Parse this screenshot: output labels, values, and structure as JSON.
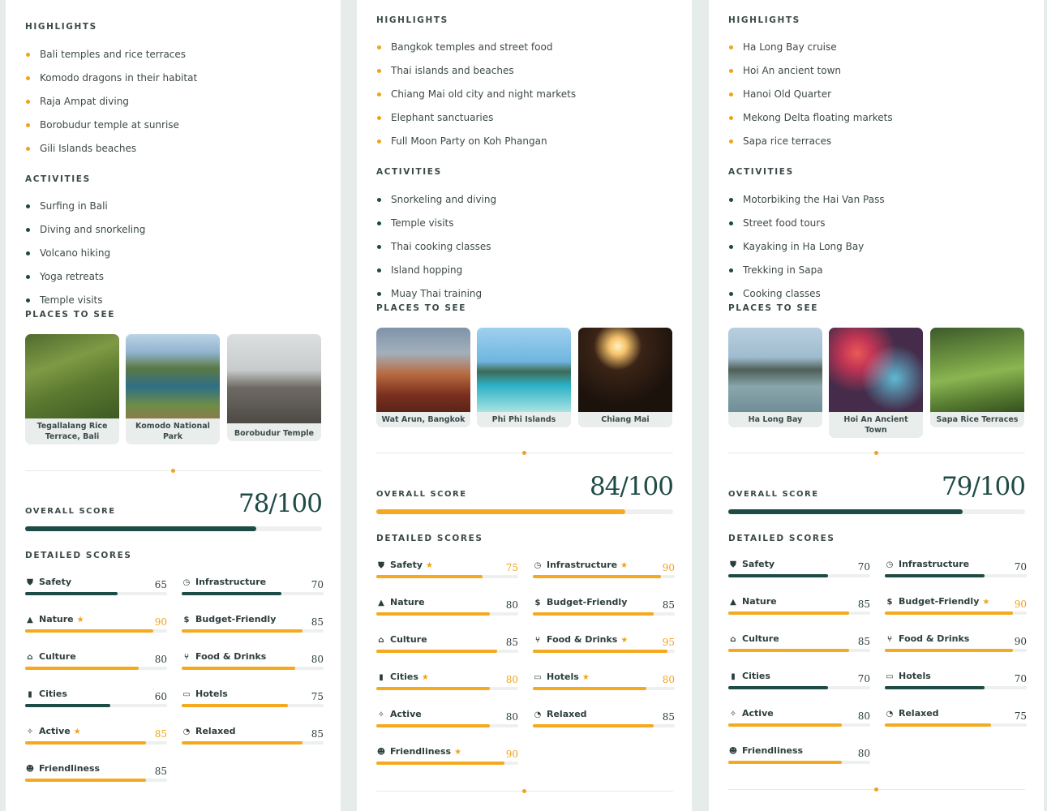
{
  "labels": {
    "highlights": "HIGHLIGHTS",
    "activities": "ACTIVITIES",
    "places": "PLACES TO SEE",
    "overall": "OVERALL SCORE",
    "detailed": "DETAILED SCORES"
  },
  "colors": {
    "accent": "#f0a21c",
    "dark_green": "#1d4b45",
    "background": "#e6ecea"
  },
  "destinations": [
    {
      "highlights": [
        "Bali temples and rice terraces",
        "Komodo dragons in their habitat",
        "Raja Ampat diving",
        "Borobudur temple at sunrise",
        "Gili Islands beaches"
      ],
      "activities": [
        "Surfing in Bali",
        "Diving and snorkeling",
        "Volcano hiking",
        "Yoga retreats",
        "Temple visits"
      ],
      "places": [
        "Tegallalang Rice Terrace, Bali",
        "Komodo National Park",
        "Borobudur Temple"
      ],
      "overall": "78/100",
      "overall_value": 78,
      "overall_bar_color": "dark_green",
      "scores": [
        {
          "name": "Safety",
          "icon": "shield-icon",
          "value": "65",
          "percent": 65,
          "star": false
        },
        {
          "name": "Infrastructure",
          "icon": "gauge-icon",
          "value": "70",
          "percent": 70,
          "star": false
        },
        {
          "name": "Nature",
          "icon": "mountain-icon",
          "value": "90",
          "percent": 90,
          "star": true
        },
        {
          "name": "Budget-Friendly",
          "icon": "dollar-icon",
          "value": "85",
          "percent": 85,
          "star": false
        },
        {
          "name": "Culture",
          "icon": "museum-icon",
          "value": "80",
          "percent": 80,
          "star": false
        },
        {
          "name": "Food & Drinks",
          "icon": "utensils-icon",
          "value": "80",
          "percent": 80,
          "star": false
        },
        {
          "name": "Cities",
          "icon": "city-icon",
          "value": "60",
          "percent": 60,
          "star": false
        },
        {
          "name": "Hotels",
          "icon": "bed-icon",
          "value": "75",
          "percent": 75,
          "star": false
        },
        {
          "name": "Active",
          "icon": "running-icon",
          "value": "85",
          "percent": 85,
          "star": true
        },
        {
          "name": "Relaxed",
          "icon": "clock-icon",
          "value": "85",
          "percent": 85,
          "star": false
        },
        {
          "name": "Friendliness",
          "icon": "smile-icon",
          "value": "85",
          "percent": 85,
          "star": false
        }
      ]
    },
    {
      "highlights": [
        "Bangkok temples and street food",
        "Thai islands and beaches",
        "Chiang Mai old city and night markets",
        "Elephant sanctuaries",
        "Full Moon Party on Koh Phangan"
      ],
      "activities": [
        "Snorkeling and diving",
        "Temple visits",
        "Thai cooking classes",
        "Island hopping",
        "Muay Thai training"
      ],
      "places": [
        "Wat Arun, Bangkok",
        "Phi Phi Islands",
        "Chiang Mai"
      ],
      "overall": "84/100",
      "overall_value": 84,
      "overall_bar_color": "gold",
      "scores": [
        {
          "name": "Safety",
          "icon": "shield-icon",
          "value": "75",
          "percent": 75,
          "star": true
        },
        {
          "name": "Infrastructure",
          "icon": "gauge-icon",
          "value": "90",
          "percent": 90,
          "star": true
        },
        {
          "name": "Nature",
          "icon": "mountain-icon",
          "value": "80",
          "percent": 80,
          "star": false
        },
        {
          "name": "Budget-Friendly",
          "icon": "dollar-icon",
          "value": "85",
          "percent": 85,
          "star": false
        },
        {
          "name": "Culture",
          "icon": "museum-icon",
          "value": "85",
          "percent": 85,
          "star": false
        },
        {
          "name": "Food & Drinks",
          "icon": "utensils-icon",
          "value": "95",
          "percent": 95,
          "star": true
        },
        {
          "name": "Cities",
          "icon": "city-icon",
          "value": "80",
          "percent": 80,
          "star": true
        },
        {
          "name": "Hotels",
          "icon": "bed-icon",
          "value": "80",
          "percent": 80,
          "star": true
        },
        {
          "name": "Active",
          "icon": "running-icon",
          "value": "80",
          "percent": 80,
          "star": false
        },
        {
          "name": "Relaxed",
          "icon": "clock-icon",
          "value": "85",
          "percent": 85,
          "star": false
        },
        {
          "name": "Friendliness",
          "icon": "smile-icon",
          "value": "90",
          "percent": 90,
          "star": true
        }
      ]
    },
    {
      "highlights": [
        "Ha Long Bay cruise",
        "Hoi An ancient town",
        "Hanoi Old Quarter",
        "Mekong Delta floating markets",
        "Sapa rice terraces"
      ],
      "activities": [
        "Motorbiking the Hai Van Pass",
        "Street food tours",
        "Kayaking in Ha Long Bay",
        "Trekking in Sapa",
        "Cooking classes"
      ],
      "places": [
        "Ha Long Bay",
        "Hoi An Ancient Town",
        "Sapa Rice Terraces"
      ],
      "overall": "79/100",
      "overall_value": 79,
      "overall_bar_color": "dark_green",
      "scores": [
        {
          "name": "Safety",
          "icon": "shield-icon",
          "value": "70",
          "percent": 70,
          "star": false
        },
        {
          "name": "Infrastructure",
          "icon": "gauge-icon",
          "value": "70",
          "percent": 70,
          "star": false
        },
        {
          "name": "Nature",
          "icon": "mountain-icon",
          "value": "85",
          "percent": 85,
          "star": false
        },
        {
          "name": "Budget-Friendly",
          "icon": "dollar-icon",
          "value": "90",
          "percent": 90,
          "star": true
        },
        {
          "name": "Culture",
          "icon": "museum-icon",
          "value": "85",
          "percent": 85,
          "star": false
        },
        {
          "name": "Food & Drinks",
          "icon": "utensils-icon",
          "value": "90",
          "percent": 90,
          "star": false
        },
        {
          "name": "Cities",
          "icon": "city-icon",
          "value": "70",
          "percent": 70,
          "star": false
        },
        {
          "name": "Hotels",
          "icon": "bed-icon",
          "value": "70",
          "percent": 70,
          "star": false
        },
        {
          "name": "Active",
          "icon": "running-icon",
          "value": "80",
          "percent": 80,
          "star": false
        },
        {
          "name": "Relaxed",
          "icon": "clock-icon",
          "value": "75",
          "percent": 75,
          "star": false
        },
        {
          "name": "Friendliness",
          "icon": "smile-icon",
          "value": "80",
          "percent": 80,
          "star": false
        }
      ]
    }
  ]
}
